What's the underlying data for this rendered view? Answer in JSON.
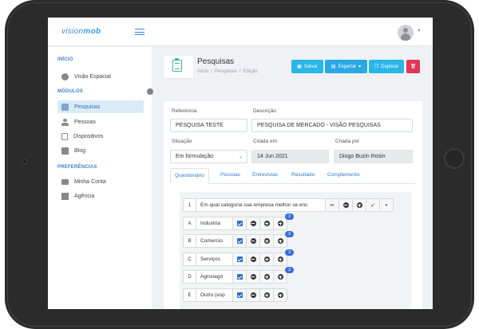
{
  "app": {
    "logo_light": "vision",
    "logo_bold": "mob"
  },
  "header": {
    "title": "Pesquisas",
    "breadcrumb": [
      "Início",
      "/",
      "Pesquisas",
      "/",
      "Edição"
    ]
  },
  "toolbar": {
    "save_label": "Salvar",
    "export_label": "Exportar",
    "duplicate_label": "Duplicar"
  },
  "sidebar": {
    "section_inicio": "INÍCIO",
    "section_modulos": "MÓDULOS",
    "section_preferencias": "PREFERÊNCIAS",
    "items": [
      {
        "label": "Visão Espacial",
        "icon": "globe-icon"
      },
      {
        "label": "Pesquisas",
        "icon": "clipboard-icon",
        "active": true
      },
      {
        "label": "Pessoas",
        "icon": "people-icon"
      },
      {
        "label": "Dispositivos",
        "icon": "device-icon"
      },
      {
        "label": "Blog",
        "icon": "blog-icon"
      },
      {
        "label": "Minha Conta",
        "icon": "id-card-icon"
      },
      {
        "label": "Agência",
        "icon": "building-icon"
      }
    ]
  },
  "form": {
    "referencia_label": "Referência",
    "referencia_value": "PESQUISA TESTE",
    "descricao_label": "Descrição",
    "descricao_value": "PESQUISA DE MERCADO - VISÃO PESQUISAS",
    "situacao_label": "Situação",
    "situacao_value": "Em formulação",
    "criada_em_label": "Criada em",
    "criada_em_value": "14 Jun 2021",
    "criada_por_label": "Criada por",
    "criada_por_value": "Diogo Buzin Rosin"
  },
  "tabs": [
    "Questionário",
    "Pessoas",
    "Entrevistas",
    "Resultado",
    "Complemento"
  ],
  "question": {
    "number": "1",
    "text": "Em qual categoria sua empresa melhor se enc"
  },
  "options": [
    {
      "letter": "A",
      "text": "Industria",
      "badge": "3"
    },
    {
      "letter": "B",
      "text": "Comercio",
      "badge": "3"
    },
    {
      "letter": "C",
      "text": "Serviços",
      "badge": "3"
    },
    {
      "letter": "D",
      "text": "Agronegó",
      "badge": "3"
    },
    {
      "letter": "E",
      "text": "Outro (esp",
      "badge": ""
    }
  ],
  "colors": {
    "accent": "#29b6e8",
    "danger": "#e0375a",
    "link": "#2f7fc5"
  }
}
